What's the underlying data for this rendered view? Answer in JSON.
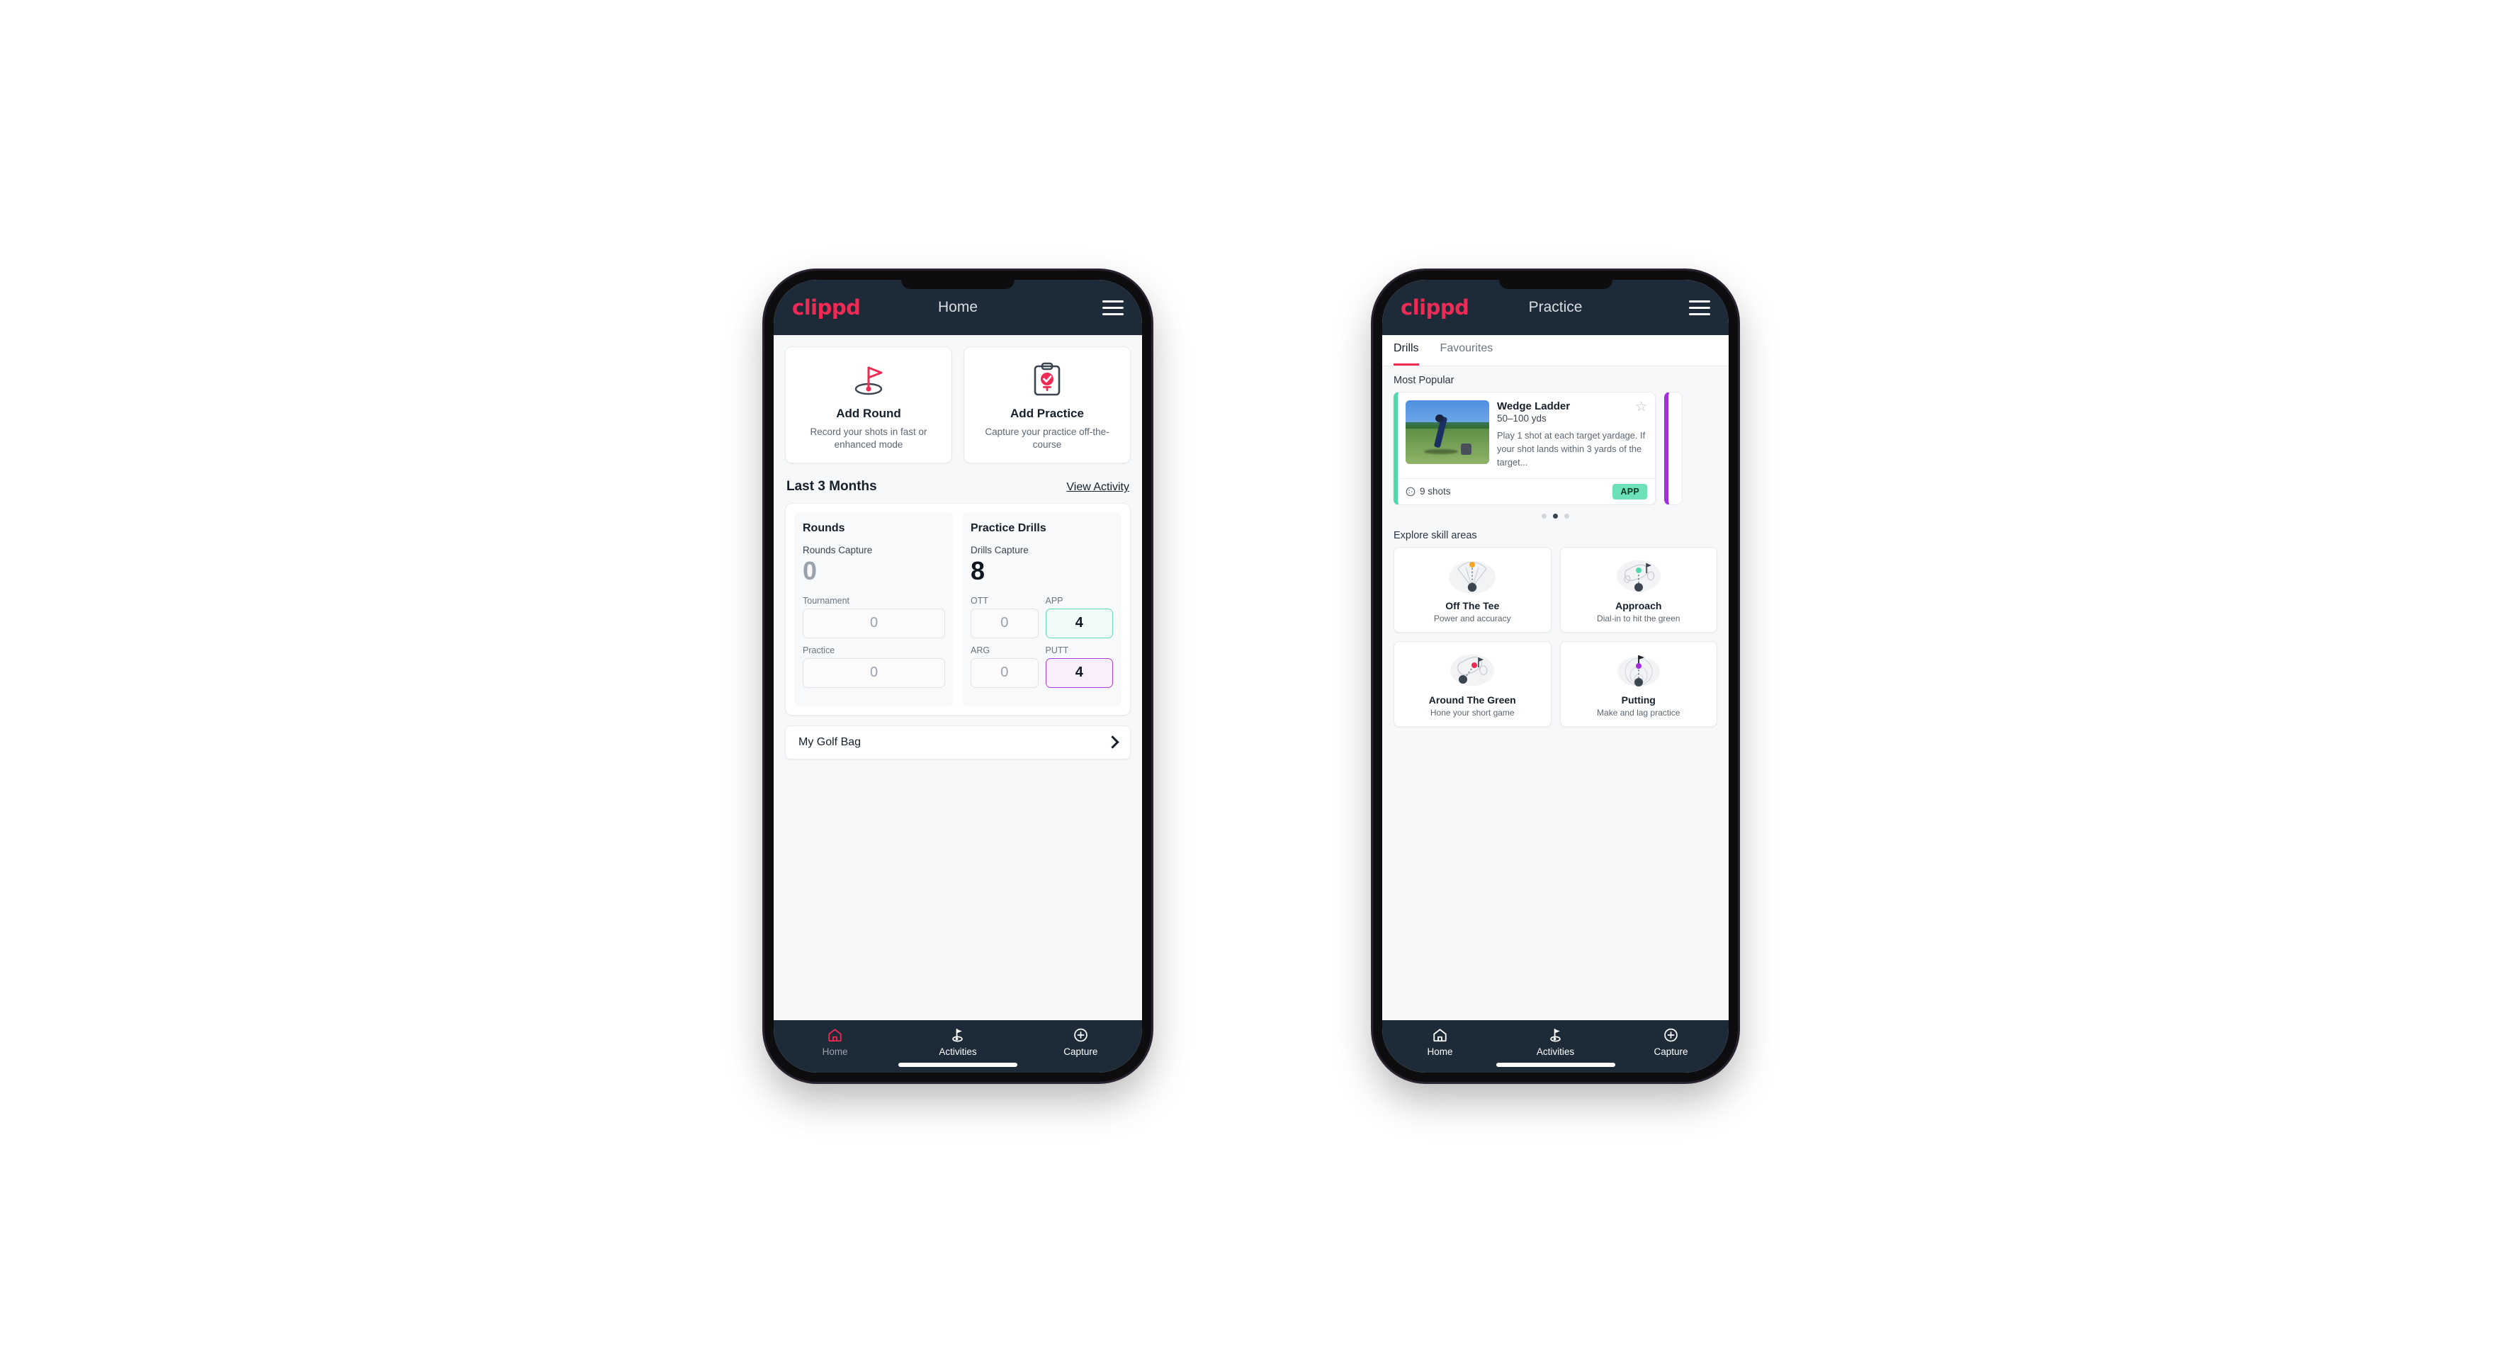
{
  "brand": {
    "logo_text": "clippd",
    "accent": "#ef2b55",
    "appbar_bg": "#1c2b37"
  },
  "phone1": {
    "appbar": {
      "title": "Home",
      "menu_icon": "hamburger-icon"
    },
    "quick_actions": [
      {
        "icon": "golf-flag-icon",
        "title": "Add Round",
        "subtitle": "Record your shots in fast or enhanced mode"
      },
      {
        "icon": "clipboard-check-icon",
        "title": "Add Practice",
        "subtitle": "Capture your practice off-the-course"
      }
    ],
    "section": {
      "title": "Last 3 Months",
      "link": "View Activity"
    },
    "rounds": {
      "heading": "Rounds",
      "capture_label": "Rounds Capture",
      "capture_value": "0",
      "fields": [
        {
          "label": "Tournament",
          "value": "0",
          "state": "empty"
        },
        {
          "label": "Practice",
          "value": "0",
          "state": "empty"
        }
      ]
    },
    "drills": {
      "heading": "Practice Drills",
      "capture_label": "Drills Capture",
      "capture_value": "8",
      "fields": [
        {
          "label": "OTT",
          "value": "0",
          "state": "empty"
        },
        {
          "label": "APP",
          "value": "4",
          "state": "app",
          "color": "#63dbb4"
        },
        {
          "label": "ARG",
          "value": "0",
          "state": "empty"
        },
        {
          "label": "PUTT",
          "value": "4",
          "state": "putt",
          "color": "#b03fd8"
        }
      ]
    },
    "golf_bag": {
      "label": "My Golf Bag",
      "icon": "chevron-right-icon"
    },
    "tabbar": [
      {
        "label": "Home",
        "icon": "home-icon",
        "active": true
      },
      {
        "label": "Activities",
        "icon": "golf-flag-icon",
        "active": false
      },
      {
        "label": "Capture",
        "icon": "plus-circle-icon",
        "active": false
      }
    ]
  },
  "phone2": {
    "appbar": {
      "title": "Practice",
      "menu_icon": "hamburger-icon"
    },
    "tabs": [
      {
        "label": "Drills",
        "selected": true
      },
      {
        "label": "Favourites",
        "selected": false
      }
    ],
    "most_popular_label": "Most Popular",
    "drill_card": {
      "name": "Wedge Ladder",
      "yardage": "50–100 yds",
      "description": "Play 1 shot at each target yardage. If your shot lands within 3 yards of the target...",
      "shots": "9 shots",
      "shots_icon": "clock-icon",
      "badge": "APP",
      "badge_color": "#6ce0b6",
      "accent": "#4fd8ab",
      "favourite_icon": "star-outline-icon",
      "thumbnail": "golfer-chipping-photo"
    },
    "peek_card_accent": "#a22ee0",
    "carousel_dots": [
      false,
      true,
      false
    ],
    "skill_section_label": "Explore skill areas",
    "skill_areas": [
      {
        "name": "Off The Tee",
        "subtitle": "Power and accuracy",
        "icon": "tee-fan-icon",
        "dot_color": "#f5a623"
      },
      {
        "name": "Approach",
        "subtitle": "Dial-in to hit the green",
        "icon": "green-approach-icon",
        "dot_color": "#4fd8ab"
      },
      {
        "name": "Around The Green",
        "subtitle": "Hone your short game",
        "icon": "chip-green-icon",
        "dot_color": "#ef2b55"
      },
      {
        "name": "Putting",
        "subtitle": "Make and lag practice",
        "icon": "putting-rings-icon",
        "dot_color": "#a22ee0"
      }
    ],
    "tabbar": [
      {
        "label": "Home",
        "icon": "home-icon",
        "active": false
      },
      {
        "label": "Activities",
        "icon": "golf-flag-icon",
        "active": true
      },
      {
        "label": "Capture",
        "icon": "plus-circle-icon",
        "active": false
      }
    ]
  }
}
